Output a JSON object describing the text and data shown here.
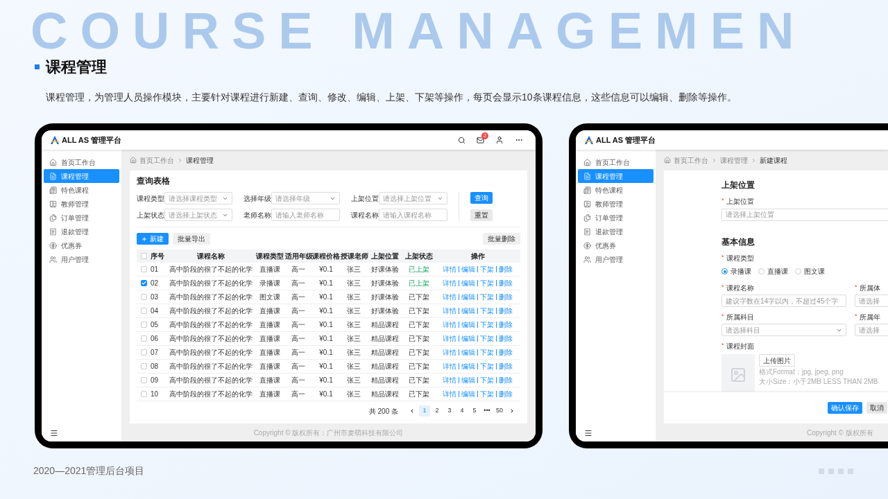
{
  "background_heading": "COURSE MANAGEMEN",
  "title": "课程管理",
  "description": "课程管理，为管理人员操作模块，主要针对课程进行新建、查询、修改、编辑、上架、下架等操作，每页会显示10条课程信息，这些信息可以编辑、删除等操作。",
  "list_screen": {
    "brand": "ALL AS 管理平台",
    "notification_count": "2",
    "sidebar": [
      {
        "label": "首页工作台",
        "selected": false
      },
      {
        "label": "课程管理",
        "selected": true
      },
      {
        "label": "特色课程",
        "selected": false
      },
      {
        "label": "教师管理",
        "selected": false
      },
      {
        "label": "订单管理",
        "selected": false
      },
      {
        "label": "退款管理",
        "selected": false
      },
      {
        "label": "优惠券",
        "selected": false
      },
      {
        "label": "用户管理",
        "selected": false
      }
    ],
    "breadcrumb": [
      "首页工作台",
      "课程管理"
    ],
    "panel_title": "查询表格",
    "filters": [
      {
        "label": "课程类型",
        "placeholder": "请选择课程类型",
        "kind": "select"
      },
      {
        "label": "选择年级",
        "placeholder": "请选择年级",
        "kind": "select"
      },
      {
        "label": "上架位置",
        "placeholder": "请选择上架位置",
        "kind": "select"
      },
      {
        "label": "上架状态",
        "placeholder": "请选择上架状态",
        "kind": "select"
      },
      {
        "label": "老师名称",
        "placeholder": "请输入老师名称",
        "kind": "input"
      },
      {
        "label": "课程名称",
        "placeholder": "请输入课程名称",
        "kind": "input"
      }
    ],
    "search_button": "查询",
    "reset_button": "重置",
    "new_button": "新建",
    "export_button": "批量导出",
    "delete_button": "批量删除",
    "table": {
      "all_checked": false,
      "columns": [
        "序号",
        "课程名称",
        "课程类型",
        "适用年级",
        "课程价格",
        "授课老师",
        "上架位置",
        "上架状态",
        "操作"
      ],
      "rows": [
        {
          "checked": false,
          "cells": [
            "01",
            "高中阶段的很了不起的化学",
            "直播课",
            "高一",
            "¥0.1",
            "张三",
            "好课体验"
          ],
          "status": {
            "text": "已上架",
            "kind": "listed"
          },
          "actions": [
            "详情",
            "编辑",
            "下架",
            "删除"
          ]
        },
        {
          "checked": true,
          "cells": [
            "02",
            "高中阶段的很了不起的化学",
            "录播课",
            "高一",
            "¥0.1",
            "张三",
            "好课体验"
          ],
          "status": {
            "text": "已上架",
            "kind": "listed"
          },
          "actions": [
            "详情",
            "编辑",
            "下架",
            "删除"
          ]
        },
        {
          "checked": false,
          "cells": [
            "03",
            "高中阶段的很了不起的化学",
            "图文课",
            "高一",
            "¥0.1",
            "张三",
            "好课体验"
          ],
          "status": {
            "text": "已下架",
            "kind": "unlisted"
          },
          "actions": [
            "详情",
            "编辑",
            "下架",
            "删除"
          ]
        },
        {
          "checked": false,
          "cells": [
            "04",
            "高中阶段的很了不起的化学",
            "直播课",
            "高一",
            "¥0.1",
            "张三",
            "好课体验"
          ],
          "status": {
            "text": "已下架",
            "kind": "unlisted"
          },
          "actions": [
            "详情",
            "编辑",
            "下架",
            "删除"
          ]
        },
        {
          "checked": false,
          "cells": [
            "05",
            "高中阶段的很了不起的化学",
            "直播课",
            "高一",
            "¥0.1",
            "张三",
            "精品课程"
          ],
          "status": {
            "text": "已下架",
            "kind": "unlisted"
          },
          "actions": [
            "详情",
            "编辑",
            "下架",
            "删除"
          ]
        },
        {
          "checked": false,
          "cells": [
            "06",
            "高中阶段的很了不起的化学",
            "直播课",
            "高一",
            "¥0.1",
            "张三",
            "精品课程"
          ],
          "status": {
            "text": "已下架",
            "kind": "unlisted"
          },
          "actions": [
            "详情",
            "编辑",
            "下架",
            "删除"
          ]
        },
        {
          "checked": false,
          "cells": [
            "07",
            "高中阶段的很了不起的化学",
            "直播课",
            "高一",
            "¥0.1",
            "张三",
            "精品课程"
          ],
          "status": {
            "text": "已下架",
            "kind": "unlisted"
          },
          "actions": [
            "详情",
            "编辑",
            "下架",
            "删除"
          ]
        },
        {
          "checked": false,
          "cells": [
            "08",
            "高中阶段的很了不起的化学",
            "直播课",
            "高一",
            "¥0.1",
            "张三",
            "精品课程"
          ],
          "status": {
            "text": "已下架",
            "kind": "unlisted"
          },
          "actions": [
            "详情",
            "编辑",
            "下架",
            "删除"
          ]
        },
        {
          "checked": false,
          "cells": [
            "09",
            "高中阶段的很了不起的化学",
            "直播课",
            "高一",
            "¥0.1",
            "张三",
            "精品课程"
          ],
          "status": {
            "text": "已下架",
            "kind": "unlisted"
          },
          "actions": [
            "详情",
            "编辑",
            "下架",
            "删除"
          ]
        },
        {
          "checked": false,
          "cells": [
            "10",
            "高中阶段的很了不起的化学",
            "直播课",
            "高一",
            "¥0.1",
            "张三",
            "精品课程"
          ],
          "status": {
            "text": "已下架",
            "kind": "unlisted"
          },
          "actions": [
            "详情",
            "编辑",
            "下架",
            "删除"
          ]
        }
      ]
    },
    "pagination": {
      "total": "共 200 条",
      "pages": [
        {
          "label": "1",
          "selected": true
        },
        {
          "label": "2",
          "selected": false
        },
        {
          "label": "3",
          "selected": false
        },
        {
          "label": "4",
          "selected": false
        },
        {
          "label": "5",
          "selected": false
        },
        {
          "label": "•••",
          "selected": false
        },
        {
          "label": "50",
          "selected": false
        }
      ]
    },
    "copyright": "Copyright © 版权所有：广州市麦萌科技有限公司"
  },
  "form_screen": {
    "brand": "ALL AS 管理平台",
    "sidebar": [
      {
        "label": "首页工作台",
        "selected": false
      },
      {
        "label": "课程管理",
        "selected": true
      },
      {
        "label": "特色课程",
        "selected": false
      },
      {
        "label": "教师管理",
        "selected": false
      },
      {
        "label": "订单管理",
        "selected": false
      },
      {
        "label": "退款管理",
        "selected": false
      },
      {
        "label": "优惠券",
        "selected": false
      },
      {
        "label": "用户管理",
        "selected": false
      }
    ],
    "breadcrumb": [
      "首页工作台",
      "课程管理",
      "新建课程"
    ],
    "required_mark": "*",
    "placement": {
      "heading": "上架位置",
      "label": "上架位置",
      "placeholder": "请选择上架位置"
    },
    "basic_heading": "基本信息",
    "type_label": "课程类型",
    "type_options": [
      {
        "label": "录播课",
        "selected": true
      },
      {
        "label": "直播课",
        "selected": false
      },
      {
        "label": "图文课",
        "selected": false
      }
    ],
    "fields": [
      {
        "label": "课程名称",
        "placeholder": "建议字数在14字以内，不超过45个字",
        "kind": "input"
      },
      {
        "label": "所属体",
        "placeholder": "请选择",
        "kind": "input"
      },
      {
        "label": "所属科目",
        "placeholder": "请选择科目",
        "kind": "select"
      },
      {
        "label": "所属年",
        "placeholder": "请选择",
        "kind": "input"
      }
    ],
    "cover_label": "课程封面",
    "upload_button": "上传图片",
    "hints": [
      "格式Format：jpg, jpeg, png",
      "大小Size：小于2MB LESS THAN 2MB"
    ],
    "save_button": "确认保存",
    "cancel_button": "取消",
    "copyright": "Copyright © 版权所有"
  },
  "caption": "2020—2021管理后台项目"
}
